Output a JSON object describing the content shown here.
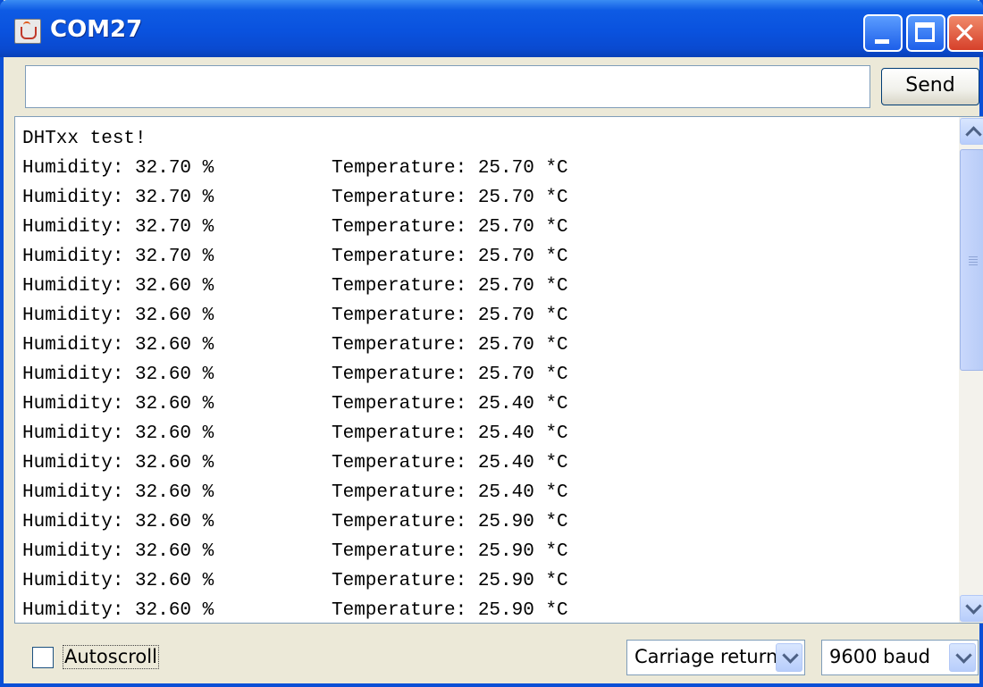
{
  "window": {
    "title": "COM27"
  },
  "send": {
    "input_value": "",
    "button_label": "Send"
  },
  "serial": {
    "lines": [
      {
        "text": "DHTxx test!"
      },
      {
        "humidity": "Humidity: 32.70 %",
        "temperature": "Temperature: 25.70 *C"
      },
      {
        "humidity": "Humidity: 32.70 %",
        "temperature": "Temperature: 25.70 *C"
      },
      {
        "humidity": "Humidity: 32.70 %",
        "temperature": "Temperature: 25.70 *C"
      },
      {
        "humidity": "Humidity: 32.70 %",
        "temperature": "Temperature: 25.70 *C"
      },
      {
        "humidity": "Humidity: 32.60 %",
        "temperature": "Temperature: 25.70 *C"
      },
      {
        "humidity": "Humidity: 32.60 %",
        "temperature": "Temperature: 25.70 *C"
      },
      {
        "humidity": "Humidity: 32.60 %",
        "temperature": "Temperature: 25.70 *C"
      },
      {
        "humidity": "Humidity: 32.60 %",
        "temperature": "Temperature: 25.70 *C"
      },
      {
        "humidity": "Humidity: 32.60 %",
        "temperature": "Temperature: 25.40 *C"
      },
      {
        "humidity": "Humidity: 32.60 %",
        "temperature": "Temperature: 25.40 *C"
      },
      {
        "humidity": "Humidity: 32.60 %",
        "temperature": "Temperature: 25.40 *C"
      },
      {
        "humidity": "Humidity: 32.60 %",
        "temperature": "Temperature: 25.40 *C"
      },
      {
        "humidity": "Humidity: 32.60 %",
        "temperature": "Temperature: 25.90 *C"
      },
      {
        "humidity": "Humidity: 32.60 %",
        "temperature": "Temperature: 25.90 *C"
      },
      {
        "humidity": "Humidity: 32.60 %",
        "temperature": "Temperature: 25.90 *C"
      },
      {
        "humidity": "Humidity: 32.60 %",
        "temperature": "Temperature: 25.90 *C"
      }
    ]
  },
  "footer": {
    "autoscroll_label": "Autoscroll",
    "autoscroll_checked": false,
    "line_ending": "Carriage return",
    "baud_rate": "9600 baud"
  },
  "icons": {
    "app": "java-cup-icon",
    "minimize": "minimize-icon",
    "maximize": "maximize-icon",
    "close": "close-icon",
    "scroll_up": "chevron-up-icon",
    "scroll_down": "chevron-down-icon",
    "dropdown": "chevron-down-icon"
  },
  "colors": {
    "titlebar": "#0a52de",
    "window_bg": "#ece9d8",
    "close_button": "#d6402a"
  }
}
